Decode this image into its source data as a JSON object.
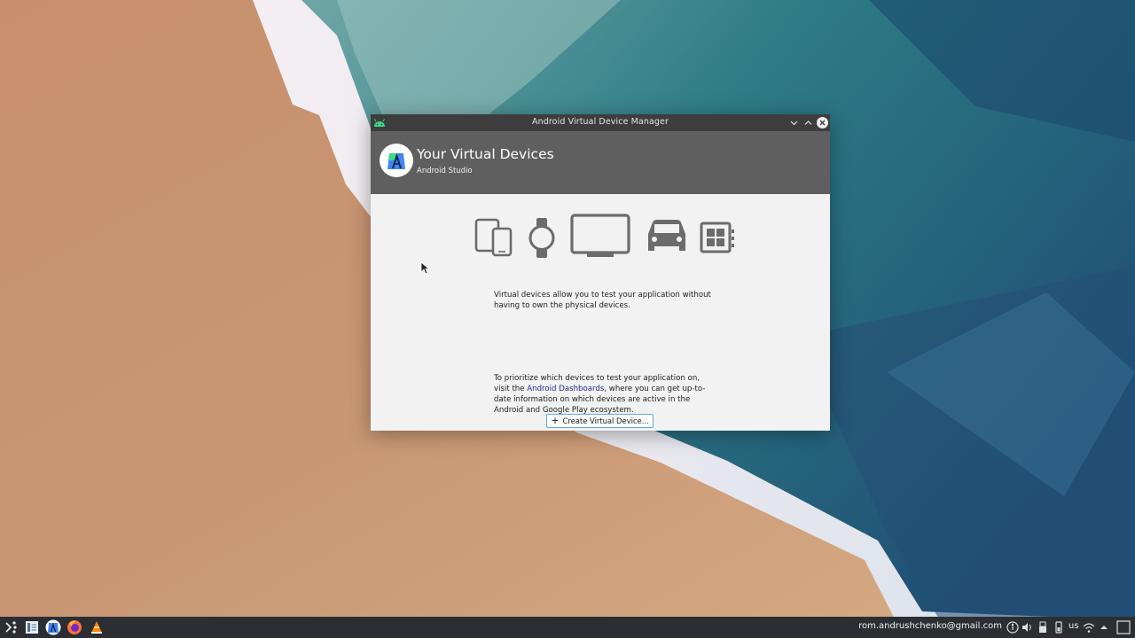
{
  "window": {
    "title": "Android Virtual Device Manager",
    "header_title": "Your Virtual Devices",
    "header_subtitle": "Android Studio"
  },
  "device_icons": [
    "phone-tablet-icon",
    "watch-icon",
    "tv-icon",
    "car-icon",
    "things-icon"
  ],
  "content": {
    "description": "Virtual devices allow you to test your application without having to own the physical devices.",
    "create_button_label": "Create Virtual Device...",
    "info_prefix": "To prioritize which devices to test your application on, visit the ",
    "info_link": "Android Dashboards",
    "info_suffix": ", where you can get up-to-date information on which devices are active in the Android and Google Play ecosystem."
  },
  "taskbar": {
    "user_email": "rom.andrushchenko@gmail.com",
    "keyboard_layout": "us"
  },
  "colors": {
    "titlebar": "#3d3d3d",
    "header": "#5f5f5f",
    "link": "#27278f",
    "button_border": "#6aa6d8",
    "android_green": "#3ddc84"
  }
}
